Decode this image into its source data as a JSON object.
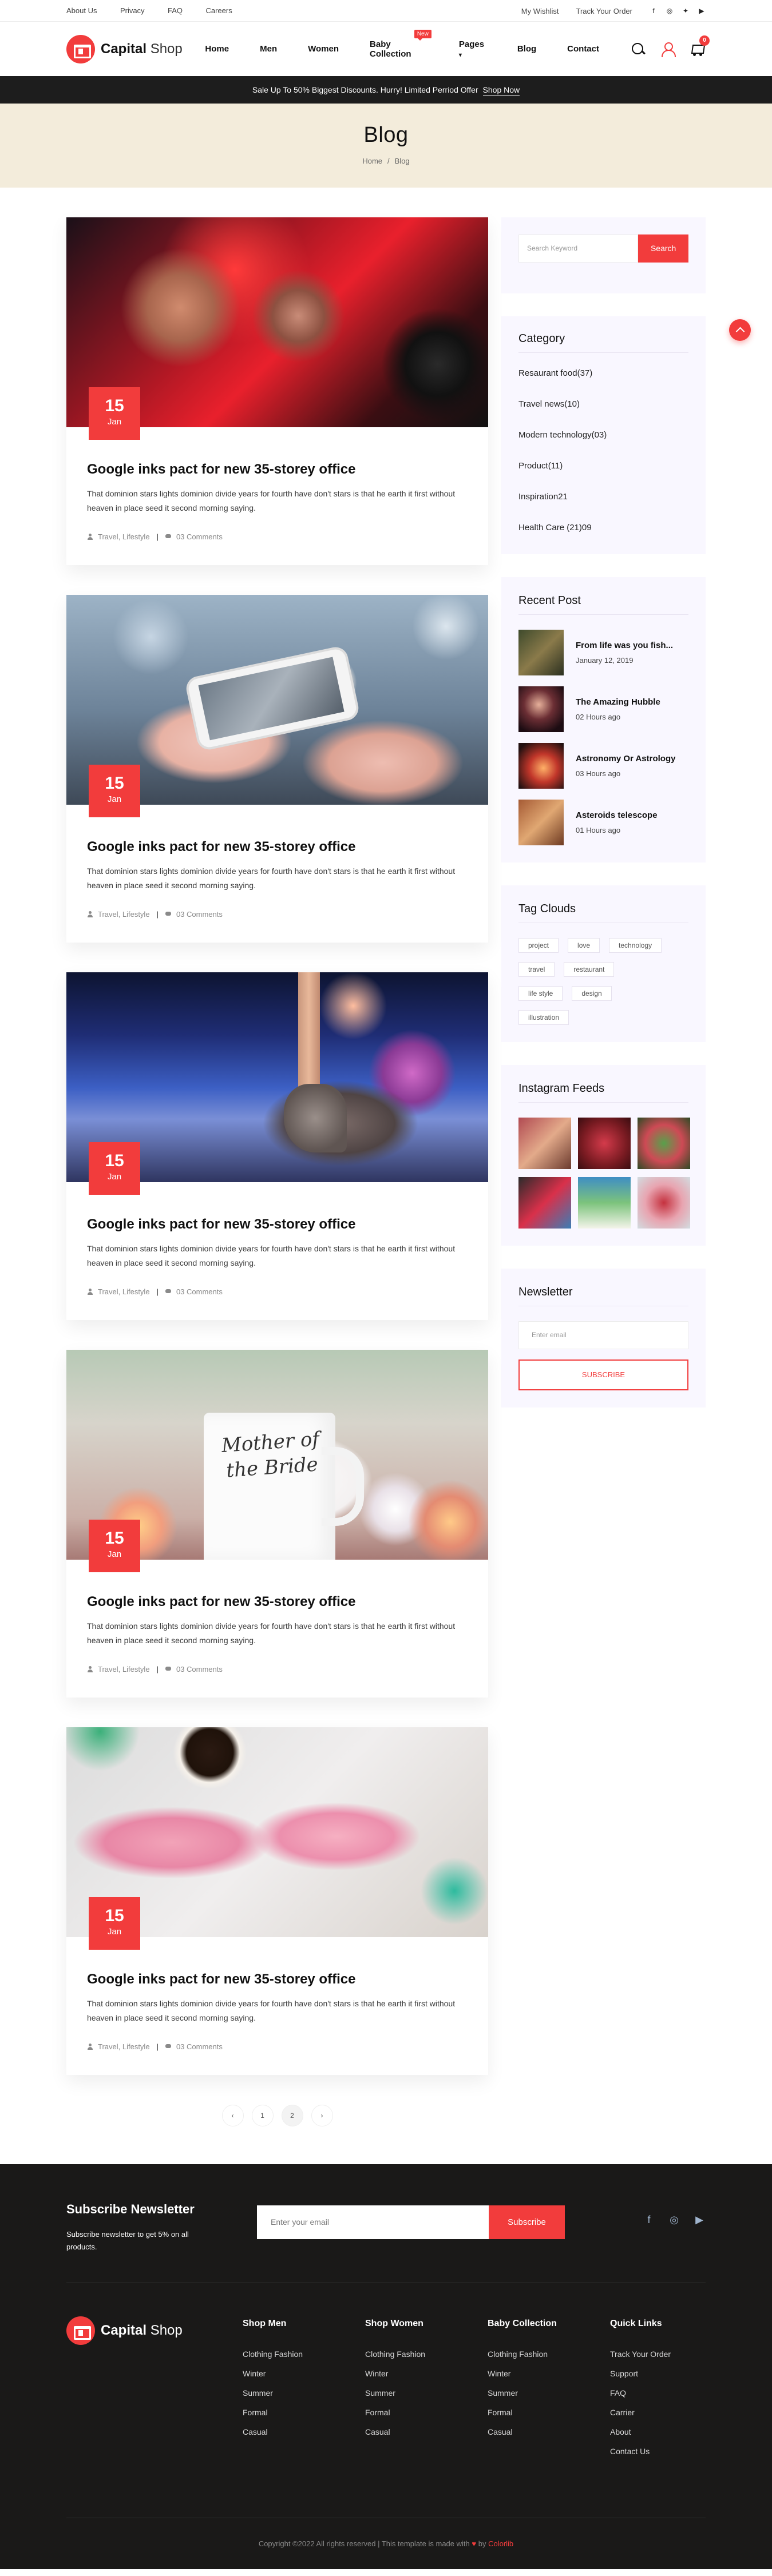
{
  "topbar": {
    "links": [
      "About Us",
      "Privacy",
      "FAQ",
      "Careers"
    ],
    "wishlist": "My Wishlist",
    "track_order": "Track Your Order",
    "social_icons": [
      "facebook-icon",
      "instagram-icon",
      "twitter-icon",
      "youtube-icon"
    ]
  },
  "header": {
    "logo_bold": "Capital",
    "logo_light": "Shop",
    "nav": [
      {
        "label": "Home"
      },
      {
        "label": "Men"
      },
      {
        "label": "Women"
      },
      {
        "label": "Baby Collection",
        "badge": "New"
      },
      {
        "label": "Pages",
        "dropdown": true
      },
      {
        "label": "Blog"
      },
      {
        "label": "Contact"
      }
    ],
    "cart_count": "0"
  },
  "promo": {
    "text": "Sale Up To 50% Biggest Discounts. Hurry! Limited Perriod Offer",
    "link": "Shop Now"
  },
  "hero": {
    "title": "Blog",
    "crumb_home": "Home",
    "crumb_sep": "/",
    "crumb_current": "Blog"
  },
  "posts": [
    {
      "day": "15",
      "month": "Jan",
      "title": "Google inks pact for new 35-storey office",
      "excerpt": "That dominion stars lights dominion divide years for fourth have don't stars is that he earth it first without heaven in place seed it second morning saying.",
      "tags": "Travel, Lifestyle",
      "comments": "03 Comments"
    },
    {
      "day": "15",
      "month": "Jan",
      "title": "Google inks pact for new 35-storey office",
      "excerpt": "That dominion stars lights dominion divide years for fourth have don't stars is that he earth it first without heaven in place seed it second morning saying.",
      "tags": "Travel, Lifestyle",
      "comments": "03 Comments"
    },
    {
      "day": "15",
      "month": "Jan",
      "title": "Google inks pact for new 35-storey office",
      "excerpt": "That dominion stars lights dominion divide years for fourth have don't stars is that he earth it first without heaven in place seed it second morning saying.",
      "tags": "Travel, Lifestyle",
      "comments": "03 Comments"
    },
    {
      "day": "15",
      "month": "Jan",
      "title": "Google inks pact for new 35-storey office",
      "excerpt": "That dominion stars lights dominion divide years for fourth have don't stars is that he earth it first without heaven in place seed it second morning saying.",
      "tags": "Travel, Lifestyle",
      "comments": "03 Comments"
    },
    {
      "day": "15",
      "month": "Jan",
      "title": "Google inks pact for new 35-storey office",
      "excerpt": "That dominion stars lights dominion divide years for fourth have don't stars is that he earth it first without heaven in place seed it second morning saying.",
      "tags": "Travel, Lifestyle",
      "comments": "03 Comments"
    }
  ],
  "mug_text": "Mother of the Bride",
  "pagination": {
    "prev": "‹",
    "pages": [
      "1",
      "2"
    ],
    "next": "›",
    "active": "2"
  },
  "sidebar": {
    "search": {
      "placeholder": "Search Keyword",
      "button": "Search"
    },
    "category": {
      "title": "Category",
      "items": [
        "Resaurant food(37)",
        "Travel news(10)",
        "Modern technology(03)",
        "Product(11)",
        "Inspiration21",
        "Health Care (21)09"
      ]
    },
    "recent": {
      "title": "Recent Post",
      "items": [
        {
          "title": "From life was you fish...",
          "date": "January 12, 2019"
        },
        {
          "title": "The Amazing Hubble",
          "date": "02 Hours ago"
        },
        {
          "title": "Astronomy Or Astrology",
          "date": "03 Hours ago"
        },
        {
          "title": "Asteroids telescope",
          "date": "01 Hours ago"
        }
      ]
    },
    "tags": {
      "title": "Tag Clouds",
      "items": [
        "project",
        "love",
        "technology",
        "travel",
        "restaurant",
        "life style",
        "design",
        "illustration"
      ]
    },
    "instagram": {
      "title": "Instagram Feeds"
    },
    "newsletter": {
      "title": "Newsletter",
      "placeholder": "Enter email",
      "button": "SUBSCRIBE"
    }
  },
  "footer": {
    "subscribe_title": "Subscribe Newsletter",
    "subscribe_text": "Subscribe newsletter to get 5% on all products.",
    "email_placeholder": "Enter your email",
    "subscribe_button": "Subscribe",
    "social_icons": [
      "facebook-icon",
      "instagram-icon",
      "youtube-icon"
    ],
    "columns": [
      {
        "title": "Shop Men",
        "links": [
          "Clothing Fashion",
          "Winter",
          "Summer",
          "Formal",
          "Casual"
        ]
      },
      {
        "title": "Shop Women",
        "links": [
          "Clothing Fashion",
          "Winter",
          "Summer",
          "Formal",
          "Casual"
        ]
      },
      {
        "title": "Baby Collection",
        "links": [
          "Clothing Fashion",
          "Winter",
          "Summer",
          "Formal",
          "Casual"
        ]
      },
      {
        "title": "Quick Links",
        "links": [
          "Track Your Order",
          "Support",
          "FAQ",
          "Carrier",
          "About",
          "Contact Us"
        ]
      }
    ],
    "copyright": "Copyright ©2022 All rights reserved | This template is made with",
    "by": "by",
    "brand": "Colorlib"
  },
  "colors": {
    "accent": "#f23c3c",
    "hero_bg": "#f3ecdb",
    "footer_bg": "#1a1918",
    "promo_bg": "#1d1d1d"
  }
}
